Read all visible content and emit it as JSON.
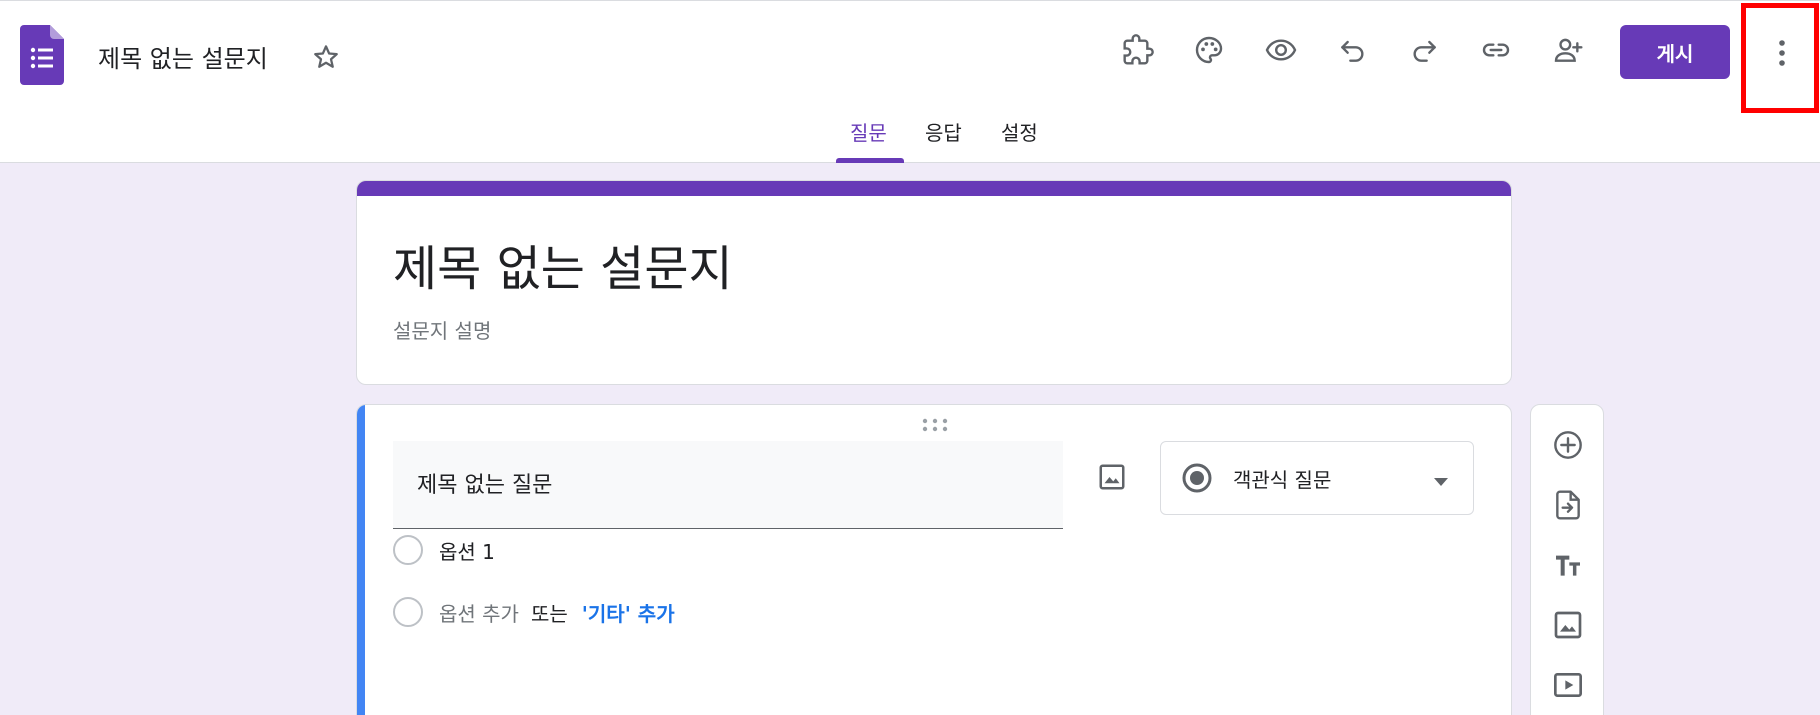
{
  "header": {
    "doc_title": "제목 없는 설문지",
    "publish_label": "게시",
    "toolbar_icons": [
      "addon-icon",
      "palette-icon",
      "preview-eye-icon",
      "undo-icon",
      "redo-icon",
      "link-icon",
      "add-collaborator-icon"
    ],
    "tabs": [
      {
        "label": "질문",
        "active": true
      },
      {
        "label": "응답",
        "active": false
      },
      {
        "label": "설정",
        "active": false
      }
    ]
  },
  "form": {
    "title": "제목 없는 설문지",
    "description_placeholder": "설문지 설명"
  },
  "question": {
    "title_value": "제목 없는 질문",
    "type_label": "객관식 질문",
    "options": [
      {
        "label": "옵션 1"
      }
    ],
    "add_option_label": "옵션 추가",
    "or_label": "또는",
    "add_other_label": "'기타' 추가"
  },
  "side_toolbar": {
    "buttons": [
      "add-question-icon",
      "import-questions-icon",
      "add-title-text-icon",
      "add-image-icon",
      "add-video-icon"
    ]
  },
  "colors": {
    "accent": "#673ab7",
    "background": "#f0ebf8",
    "active_question_bar": "#4285f4",
    "link": "#1a73e8",
    "highlight": "#ff0000"
  }
}
